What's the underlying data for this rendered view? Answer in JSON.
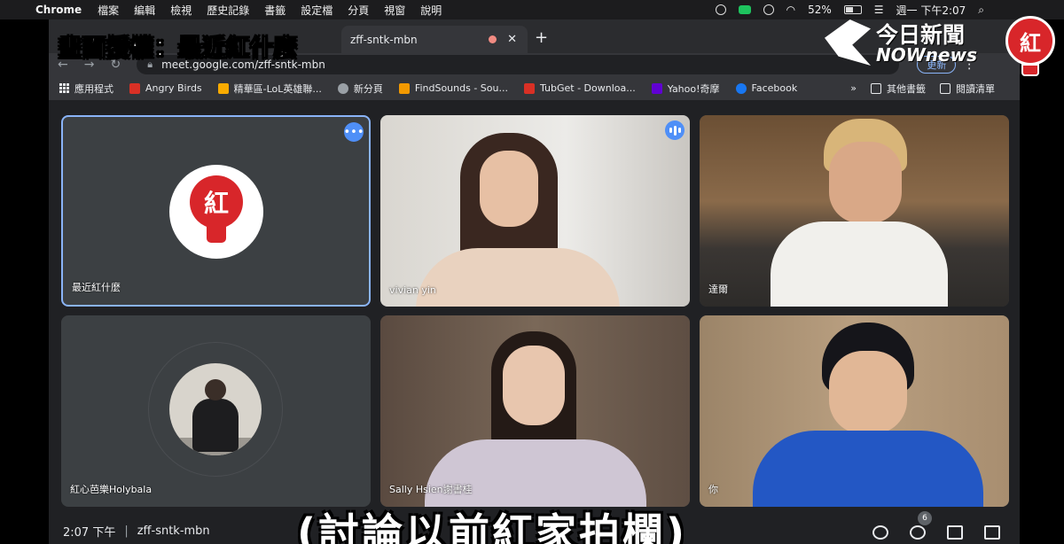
{
  "menubar": {
    "app": "Chrome",
    "items": [
      "檔案",
      "編輯",
      "檢視",
      "歷史記錄",
      "書籤",
      "設定檔",
      "分頁",
      "視窗",
      "說明"
    ],
    "battery": "52%",
    "battery_level": 0.52,
    "clock": "週一 下午2:07"
  },
  "tab": {
    "title": "zff-sntk-mbn"
  },
  "address": {
    "url": "meet.google.com/zff-sntk-mbn",
    "update_label": "更新"
  },
  "bookmarks": {
    "items": [
      {
        "label": "應用程式",
        "color": "#e8eaed"
      },
      {
        "label": "Angry Birds",
        "color": "#d93025"
      },
      {
        "label": "精華區-LoL英雄聯...",
        "color": "#f9ab00"
      },
      {
        "label": "新分頁",
        "color": "#9aa0a6"
      },
      {
        "label": "FindSounds - Sou...",
        "color": "#f29900"
      },
      {
        "label": "TubGet - Downloa...",
        "color": "#d93025"
      },
      {
        "label": "Yahoo!奇摩",
        "color": "#6001d2"
      },
      {
        "label": "Facebook",
        "color": "#1877f2"
      }
    ],
    "overflow": "»",
    "other": "其他書籤",
    "reading_list": "閱讀清單"
  },
  "participants": [
    {
      "name": "最近紅什麼",
      "type": "logo"
    },
    {
      "name": "vivian yin",
      "type": "video"
    },
    {
      "name": "達爾",
      "type": "video"
    },
    {
      "name": "紅心芭樂Holybala",
      "type": "avatar"
    },
    {
      "name": "Sally Hsien謝書桂",
      "type": "video"
    },
    {
      "name": "你",
      "type": "video"
    }
  ],
  "bottom": {
    "time": "2:07 下午",
    "meeting_code": "zff-sntk-mbn",
    "participant_count": "6"
  },
  "overlay": {
    "top_caption": "畫面授權：最近紅什麼",
    "subtitle": "(討論以前紅家拍欄)",
    "brand_top": "今日新聞",
    "brand_bottom": "NOWnews",
    "logo_char": "紅"
  }
}
